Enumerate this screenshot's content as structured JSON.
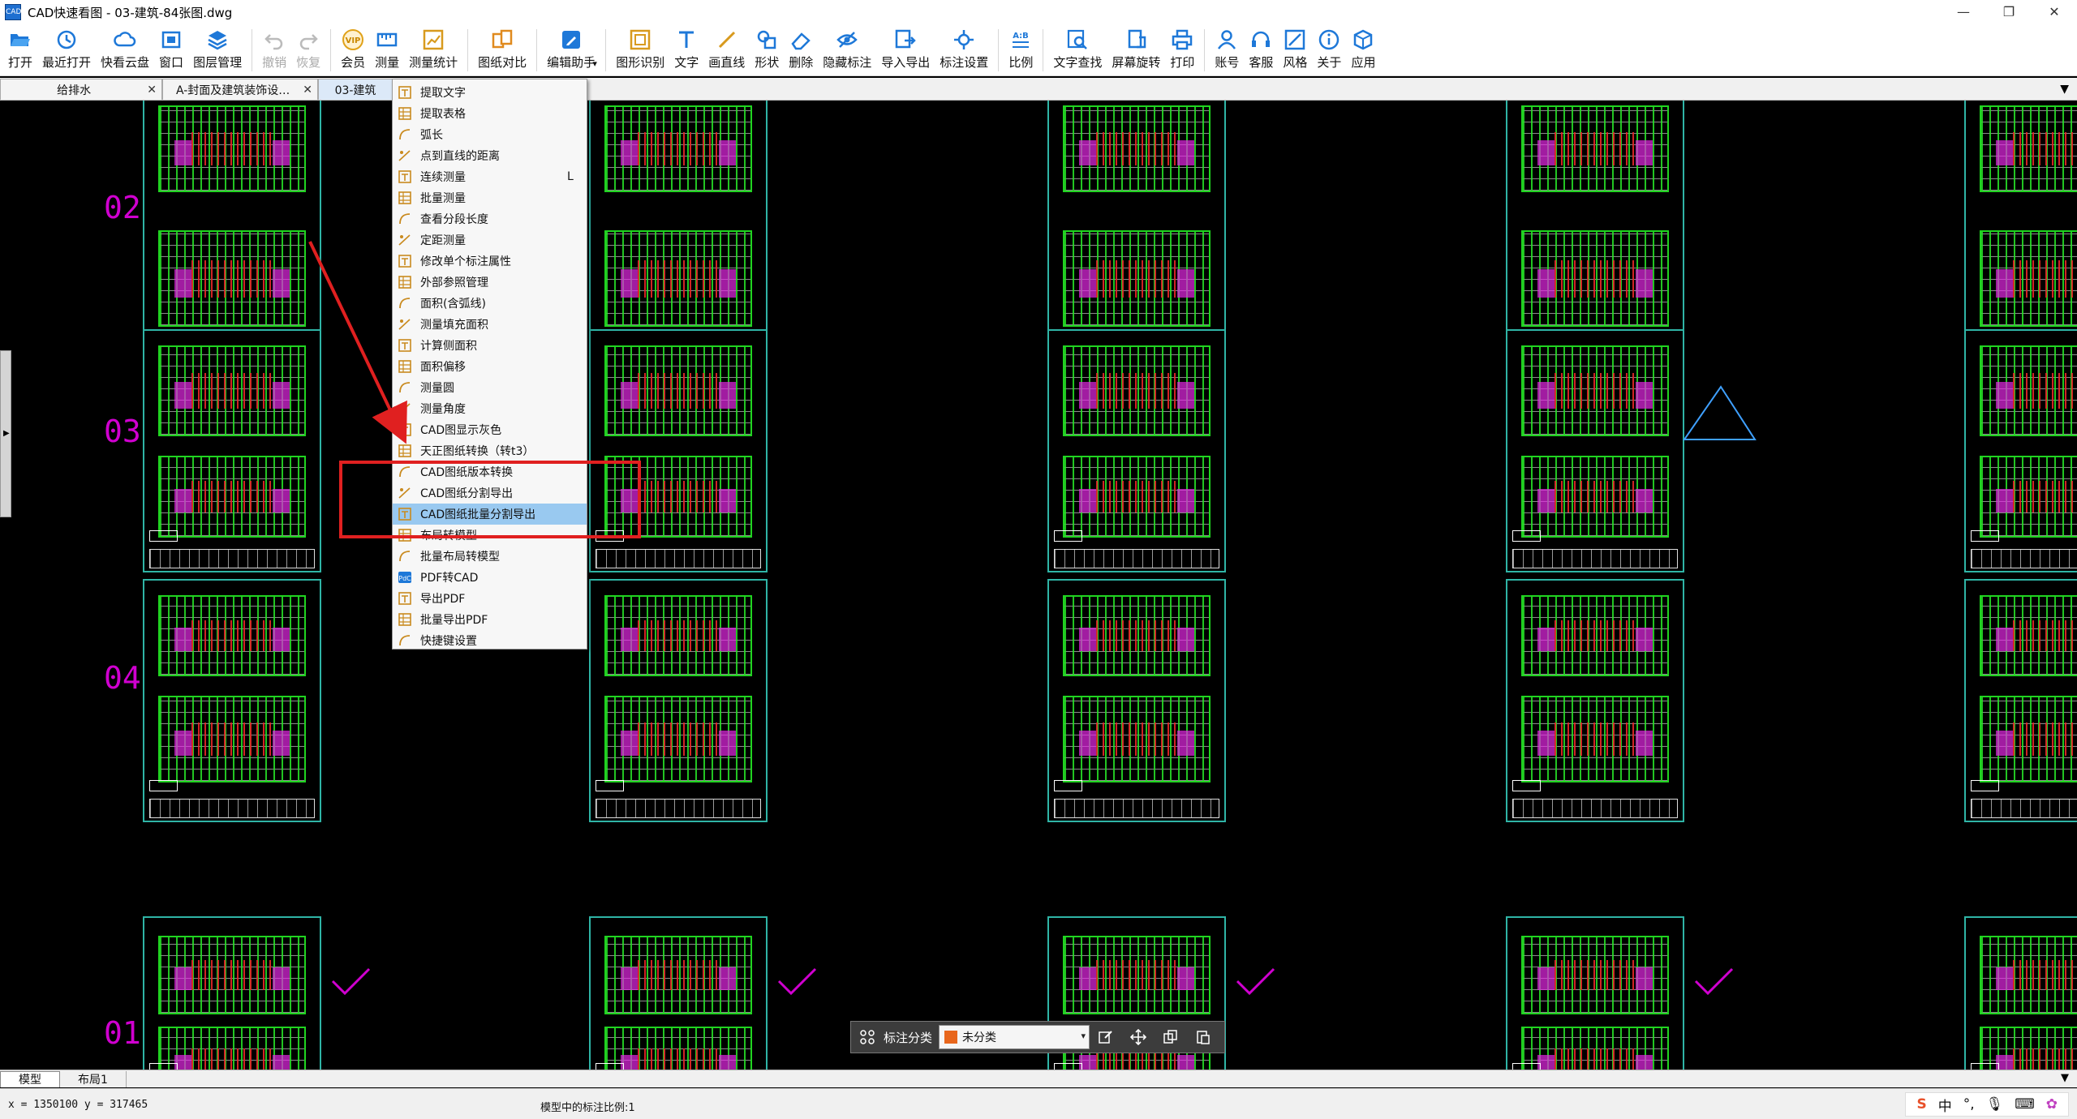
{
  "window": {
    "title": "CAD快速看图 - 03-建筑-84张图.dwg",
    "app_icon_text": "CAD",
    "minimize": "—",
    "maximize": "❐",
    "close": "✕"
  },
  "toolbar": {
    "items": [
      {
        "label": "打开",
        "icon": "folder-open-icon",
        "enabled": true
      },
      {
        "label": "最近打开",
        "icon": "clock-icon",
        "enabled": true
      },
      {
        "label": "快看云盘",
        "icon": "cloud-icon",
        "enabled": true
      },
      {
        "label": "窗口",
        "icon": "window-icon",
        "enabled": true
      },
      {
        "label": "图层管理",
        "icon": "layers-icon",
        "enabled": true
      },
      {
        "label": "撤销",
        "icon": "undo-icon",
        "enabled": false
      },
      {
        "label": "恢复",
        "icon": "redo-icon",
        "enabled": false
      },
      {
        "label": "会员",
        "icon": "vip-icon",
        "enabled": true
      },
      {
        "label": "测量",
        "icon": "ruler-icon",
        "enabled": true
      },
      {
        "label": "测量统计",
        "icon": "measure-stats-icon",
        "enabled": true
      },
      {
        "label": "图纸对比",
        "icon": "compare-icon",
        "enabled": true
      },
      {
        "label": "编辑助手",
        "icon": "edit-assistant-icon",
        "enabled": true
      },
      {
        "label": "图形识别",
        "icon": "shape-recognition-icon",
        "enabled": true
      },
      {
        "label": "文字",
        "icon": "text-icon",
        "enabled": true
      },
      {
        "label": "画直线",
        "icon": "line-icon",
        "enabled": true
      },
      {
        "label": "形状",
        "icon": "shapes-icon",
        "enabled": true
      },
      {
        "label": "删除",
        "icon": "eraser-icon",
        "enabled": true
      },
      {
        "label": "隐藏标注",
        "icon": "eye-hidden-icon",
        "enabled": true
      },
      {
        "label": "导入导出",
        "icon": "import-export-icon",
        "enabled": true
      },
      {
        "label": "标注设置",
        "icon": "annotation-settings-icon",
        "enabled": true
      },
      {
        "label": "比例",
        "icon": "scale-icon",
        "enabled": true
      },
      {
        "label": "文字查找",
        "icon": "text-search-icon",
        "enabled": true
      },
      {
        "label": "屏幕旋转",
        "icon": "rotate-screen-icon",
        "enabled": true
      },
      {
        "label": "打印",
        "icon": "printer-icon",
        "enabled": true
      },
      {
        "label": "账号",
        "icon": "user-icon",
        "enabled": true
      },
      {
        "label": "客服",
        "icon": "headset-icon",
        "enabled": true
      },
      {
        "label": "风格",
        "icon": "style-icon",
        "enabled": true
      },
      {
        "label": "关于",
        "icon": "info-icon",
        "enabled": true
      },
      {
        "label": "应用",
        "icon": "apps-cube-icon",
        "enabled": true
      }
    ],
    "dropdown_caret": "▾",
    "scale_icon_text": "A:B"
  },
  "tabs": [
    {
      "label": "给排水",
      "close": "✕",
      "active": false
    },
    {
      "label": "A-封面及建筑装饰设…",
      "close": "✕",
      "active": false
    },
    {
      "label": "03-建筑",
      "close": "",
      "active": true
    }
  ],
  "tab_menu_caret": "▼",
  "canvas": {
    "row_labels": [
      "02",
      "03",
      "04",
      "01"
    ],
    "side_handle_arrow": "▶"
  },
  "context_menu": {
    "items": [
      {
        "label": "提取文字",
        "icon": "text-extract-icon",
        "shortcut": ""
      },
      {
        "label": "提取表格",
        "icon": "table-extract-icon",
        "shortcut": ""
      },
      {
        "label": "弧长",
        "icon": "arc-length-icon",
        "shortcut": ""
      },
      {
        "label": "点到直线的距离",
        "icon": "point-line-distance-icon",
        "shortcut": ""
      },
      {
        "label": "连续测量",
        "icon": "continuous-measure-icon",
        "shortcut": "L"
      },
      {
        "label": "批量测量",
        "icon": "batch-measure-icon",
        "shortcut": ""
      },
      {
        "label": "查看分段长度",
        "icon": "segment-length-icon",
        "shortcut": ""
      },
      {
        "label": "定距测量",
        "icon": "fixed-distance-icon",
        "shortcut": ""
      },
      {
        "label": "修改单个标注属性",
        "icon": "edit-annotation-icon",
        "shortcut": ""
      },
      {
        "label": "外部参照管理",
        "icon": "xref-icon",
        "shortcut": ""
      },
      {
        "label": "面积(含弧线)",
        "icon": "area-arc-icon",
        "shortcut": ""
      },
      {
        "label": "测量填充面积",
        "icon": "fill-area-icon",
        "shortcut": ""
      },
      {
        "label": "计算侧面积",
        "icon": "side-area-icon",
        "shortcut": ""
      },
      {
        "label": "面积偏移",
        "icon": "area-offset-icon",
        "shortcut": ""
      },
      {
        "label": "测量圆",
        "icon": "circle-measure-icon",
        "shortcut": ""
      },
      {
        "label": "测量角度",
        "icon": "angle-icon",
        "shortcut": ""
      },
      {
        "label": "CAD图显示灰色",
        "icon": "gray-display-icon",
        "shortcut": ""
      },
      {
        "label": "天正图纸转换（转t3）",
        "icon": "tangent-convert-icon",
        "shortcut": ""
      },
      {
        "label": "CAD图纸版本转换",
        "icon": "version-convert-icon",
        "shortcut": ""
      },
      {
        "label": "CAD图纸分割导出",
        "icon": "split-export-icon",
        "shortcut": ""
      },
      {
        "label": "CAD图纸批量分割导出",
        "icon": "batch-split-export-icon",
        "shortcut": "",
        "highlight": true
      },
      {
        "label": "布局转模型",
        "icon": "layout-to-model-icon",
        "shortcut": ""
      },
      {
        "label": "批量布局转模型",
        "icon": "batch-layout-model-icon",
        "shortcut": ""
      },
      {
        "label": "PDF转CAD",
        "icon": "pdf-to-cad-icon",
        "shortcut": ""
      },
      {
        "label": "导出PDF",
        "icon": "export-pdf-icon",
        "shortcut": ""
      },
      {
        "label": "批量导出PDF",
        "icon": "batch-export-pdf-icon",
        "shortcut": ""
      },
      {
        "label": "快捷键设置",
        "icon": "keyboard-icon",
        "shortcut": ""
      }
    ]
  },
  "label_toolbar": {
    "category_label": "标注分类",
    "selected_category": "未分类",
    "swatch_color": "#e8661c",
    "caret": "▾"
  },
  "model_tabs": [
    {
      "label": "模型",
      "active": true
    },
    {
      "label": "布局1",
      "active": false
    }
  ],
  "status": {
    "coords": "x = 1350100  y = 317465",
    "scale_text": "模型中的标注比例:1",
    "tray": [
      "S",
      "中",
      "°,",
      "🎙",
      "⌨",
      "✿"
    ]
  },
  "colors": {
    "accent_red": "#e02020",
    "sheet_border": "#2fb4a6",
    "row_label": "#d000d0",
    "menu_highlight": "#99c9f0"
  }
}
